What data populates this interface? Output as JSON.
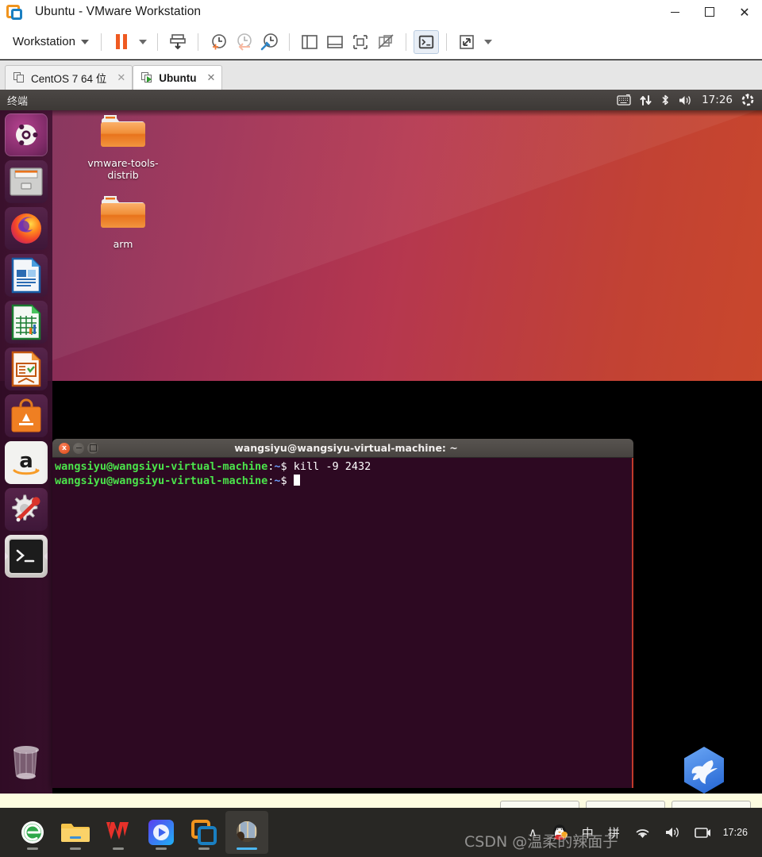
{
  "window": {
    "title": "Ubuntu - VMware Workstation",
    "app_icon": "vmware-icon",
    "minimize": "—",
    "maximize": "□",
    "close": "✕"
  },
  "toolbar": {
    "workstation_menu": "Workstation",
    "buttons": [
      {
        "name": "suspend-button",
        "icon": "pause-icon",
        "label": "Suspend"
      },
      {
        "name": "power-dropdown",
        "icon": "chevron-down-icon",
        "label": ""
      },
      {
        "name": "send-ctrl-alt-del-button",
        "icon": "send-keys-icon",
        "label": "Send Ctrl+Alt+Del"
      },
      {
        "name": "take-snapshot-button",
        "icon": "snapshot-add-icon",
        "label": "Take Snapshot"
      },
      {
        "name": "revert-snapshot-button",
        "icon": "snapshot-revert-icon",
        "label": "Revert Snapshot"
      },
      {
        "name": "snapshot-manager-button",
        "icon": "snapshot-manager-icon",
        "label": "Manage Snapshots"
      },
      {
        "name": "show-sidebar-button",
        "icon": "sidebar-panel-icon",
        "label": "Show Library"
      },
      {
        "name": "show-console-view-button",
        "icon": "bottom-panel-icon",
        "label": "Console View"
      },
      {
        "name": "show-thumbnails-button",
        "icon": "thumbnail-bar-icon",
        "label": "Thumbnail Bar"
      },
      {
        "name": "hide-thumbnails-button",
        "icon": "thumbnail-bar-off-icon",
        "label": "Hide Thumbnails"
      },
      {
        "name": "unity-mode-button",
        "icon": "terminal-console-icon",
        "label": "Console"
      },
      {
        "name": "fullscreen-button",
        "icon": "fullscreen-icon",
        "label": "Full Screen"
      },
      {
        "name": "fullscreen-dropdown",
        "icon": "chevron-down-icon",
        "label": ""
      }
    ]
  },
  "vm_tabs": [
    {
      "label": "CentOS 7 64 位",
      "active": false,
      "close": "✕"
    },
    {
      "label": "Ubuntu",
      "active": true,
      "close": "✕"
    }
  ],
  "guest": {
    "panel": {
      "app_title": "终端",
      "clock": "17:26",
      "indicators": [
        {
          "name": "keyboard-indicator-icon"
        },
        {
          "name": "network-indicator-icon"
        },
        {
          "name": "bluetooth-indicator-icon"
        },
        {
          "name": "volume-indicator-icon"
        },
        {
          "name": "clock-indicator"
        },
        {
          "name": "session-power-indicator-icon"
        }
      ]
    },
    "launcher": [
      {
        "name": "launcher-item-dash",
        "label": "Ubuntu Dash",
        "icon": "ubuntu-logo-icon"
      },
      {
        "name": "launcher-item-files",
        "label": "Files",
        "icon": "files-cabinet-icon"
      },
      {
        "name": "launcher-item-firefox",
        "label": "Firefox Web Browser",
        "icon": "firefox-icon"
      },
      {
        "name": "launcher-item-writer",
        "label": "LibreOffice Writer",
        "icon": "libreoffice-writer-icon"
      },
      {
        "name": "launcher-item-calc",
        "label": "LibreOffice Calc",
        "icon": "libreoffice-calc-icon"
      },
      {
        "name": "launcher-item-impress",
        "label": "LibreOffice Impress",
        "icon": "libreoffice-impress-icon"
      },
      {
        "name": "launcher-item-software",
        "label": "Ubuntu Software",
        "icon": "ubuntu-software-icon"
      },
      {
        "name": "launcher-item-amazon",
        "label": "Amazon",
        "icon": "amazon-icon"
      },
      {
        "name": "launcher-item-settings",
        "label": "System Settings",
        "icon": "system-settings-icon"
      },
      {
        "name": "launcher-item-terminal",
        "label": "Terminal",
        "icon": "terminal-icon",
        "running": true
      },
      {
        "name": "launcher-item-trash",
        "label": "Trash",
        "icon": "trash-icon"
      }
    ],
    "desktop_icons": [
      {
        "name": "desktop-folder-vmware-tools",
        "label": "vmware-tools-distrib",
        "icon": "folder-icon"
      },
      {
        "name": "desktop-folder-arm",
        "label": "arm",
        "icon": "folder-icon"
      }
    ],
    "terminal": {
      "title": "wangsiyu@wangsiyu-virtual-machine: ~",
      "prompt_user": "wangsiyu@wangsiyu-virtual-machine",
      "prompt_colon": ":",
      "prompt_path": "~",
      "prompt_dollar": "$",
      "lines": [
        {
          "command": " kill -9 2432"
        },
        {
          "command": " "
        }
      ],
      "window_buttons": {
        "close": "x",
        "minimize": "",
        "maximize": ""
      }
    },
    "floating_icon": {
      "name": "bird-app-icon",
      "label": "hummingbird"
    }
  },
  "taskbar": {
    "apps": [
      {
        "name": "taskbar-item-360-browser",
        "label": "360 Browser",
        "icon": "360-browser-icon",
        "active": false
      },
      {
        "name": "taskbar-item-file-explorer",
        "label": "File Explorer",
        "icon": "folder-icon",
        "active": false
      },
      {
        "name": "taskbar-item-wps",
        "label": "WPS Office",
        "icon": "wps-icon",
        "active": false
      },
      {
        "name": "taskbar-item-video-player",
        "label": "Video Player",
        "icon": "media-play-icon",
        "active": false
      },
      {
        "name": "taskbar-item-vmware",
        "label": "VMware Workstation",
        "icon": "vmware-icon",
        "active": false
      },
      {
        "name": "taskbar-item-window-thumb",
        "label": "Window",
        "icon": "window-thumbnail-icon",
        "active": true
      }
    ],
    "tray": {
      "overflow": "∧",
      "qq": "QQ",
      "ime_mode": "中",
      "ime_pinyin": "拼",
      "wifi": "wifi-icon",
      "volume": "volume-icon",
      "notification": "notification-icon",
      "time": "17:26",
      "date": ""
    },
    "watermark": "CSDN @温柔的辣面子"
  },
  "colors": {
    "vmware_orange": "#f0941e",
    "vmware_blue": "#1a7fc1",
    "ubuntu_orange": "#dd4814",
    "terminal_bg": "#2d0922",
    "terminal_green": "#4be44b",
    "terminal_blue": "#6a9bfb",
    "taskbar_bg": "#282724",
    "accent_blue": "#4cb7f2"
  }
}
